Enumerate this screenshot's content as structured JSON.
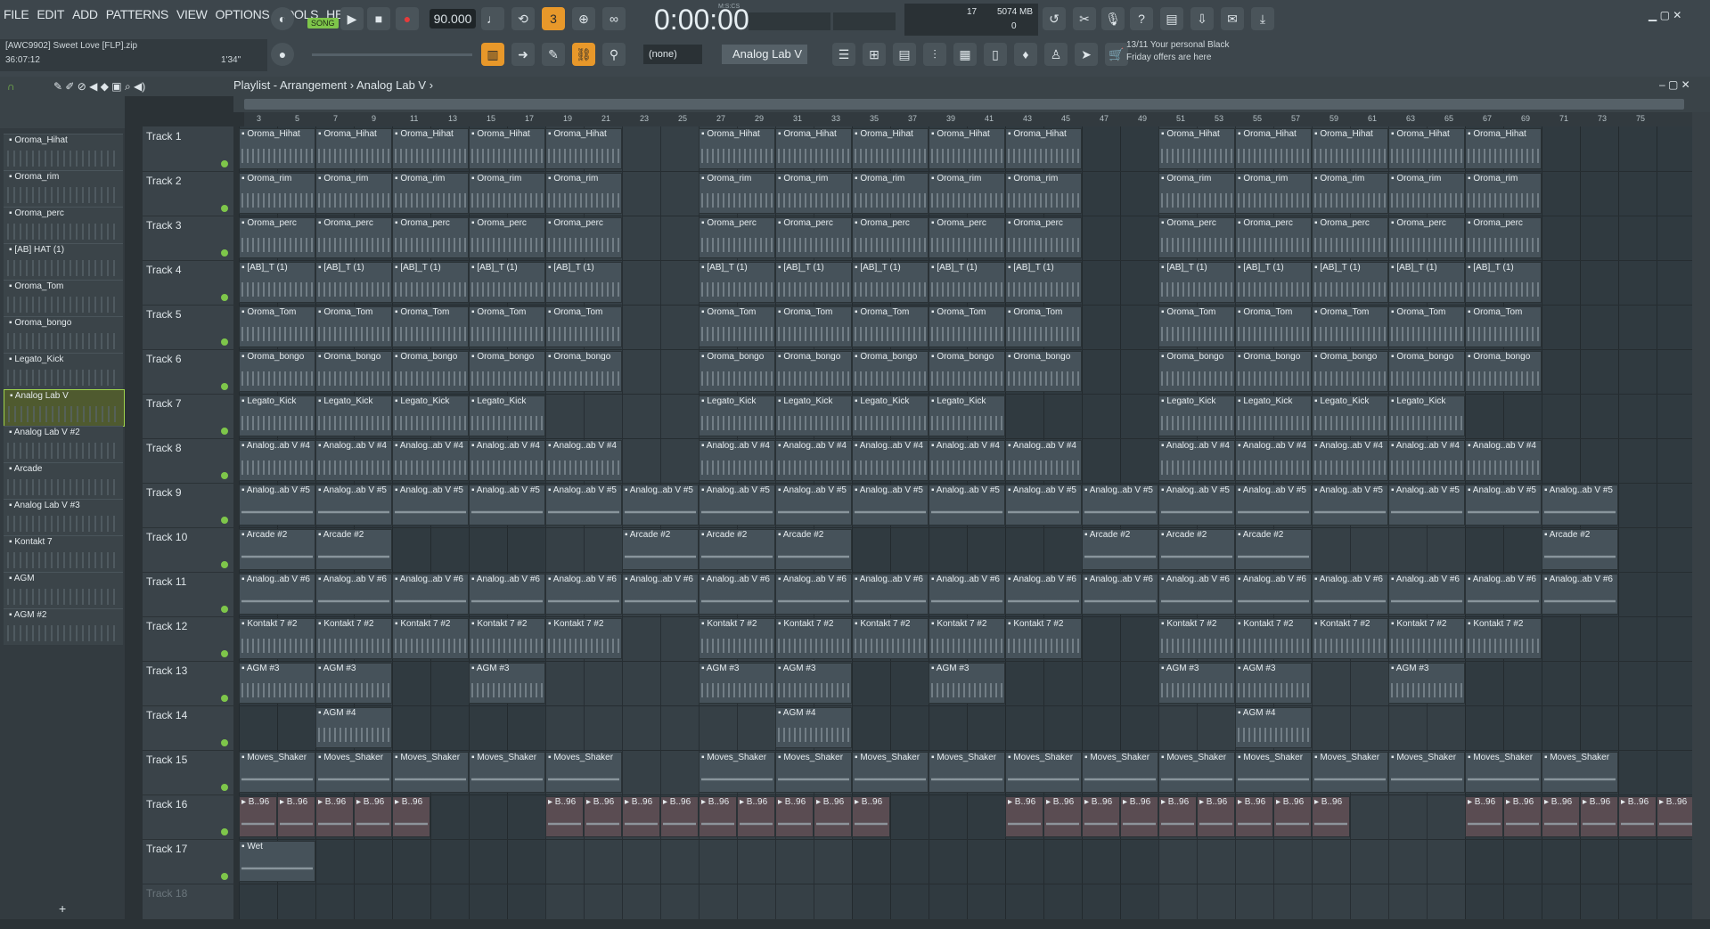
{
  "menu": [
    "FILE",
    "EDIT",
    "ADD",
    "PATTERNS",
    "VIEW",
    "OPTIONS",
    "TOOLS",
    "HELP"
  ],
  "transport": {
    "mode_label": "SONG",
    "tempo": "90.000",
    "time": "0:00:00",
    "time_unit": "M:S:CS"
  },
  "project": {
    "file": "[AWC9902] Sweet Love [FLP].zip",
    "time": "36:07:12",
    "length": "1'34\""
  },
  "cpu": {
    "voices": "17",
    "memory": "5074 MB",
    "zero": "0"
  },
  "pattern_selector": "(none)",
  "channel_selector": "Analog Lab V",
  "promo": {
    "count": "13/11",
    "line1": "Your personal Black",
    "line2": "Friday offers are here"
  },
  "playlist": {
    "title": "Playlist - Arrangement",
    "current": "Analog Lab V"
  },
  "ruler": [
    "3",
    "5",
    "7",
    "9",
    "11",
    "13",
    "15",
    "17",
    "19",
    "21",
    "23",
    "25",
    "27",
    "29",
    "31",
    "33",
    "35",
    "37",
    "39",
    "41",
    "43",
    "45",
    "47",
    "49",
    "51",
    "53",
    "55",
    "57",
    "59",
    "61",
    "63",
    "65",
    "67",
    "69",
    "71",
    "73",
    "75"
  ],
  "channels": [
    "Oroma_Hihat",
    "Oroma_rim",
    "Oroma_perc",
    "[AB] HAT (1)",
    "Oroma_Tom",
    "Oroma_bongo",
    "Legato_Kick",
    "Analog Lab V",
    "Analog Lab V #2",
    "Arcade",
    "Analog Lab V #3",
    "Kontakt 7",
    "AGM",
    "AGM #2"
  ],
  "tracks": [
    "Track 1",
    "Track 2",
    "Track 3",
    "Track 4",
    "Track 5",
    "Track 6",
    "Track 7",
    "Track 8",
    "Track 9",
    "Track 10",
    "Track 11",
    "Track 12",
    "Track 13",
    "Track 14",
    "Track 15",
    "Track 16",
    "Track 17",
    "Track 18"
  ],
  "clip_labels": {
    "t1": "Oroma_Hihat",
    "t2": "Oroma_rim",
    "t3": "Oroma_perc",
    "t4": "[AB]_T (1)",
    "t5": "Oroma_Tom",
    "t6": "Oroma_bongo",
    "t7": "Legato_Kick",
    "t8": "Analog..ab V #4",
    "t9": "Analog..ab V #5",
    "t10": "Arcade #2",
    "t11": "Analog..ab V #6",
    "t12": "Kontakt 7 #2",
    "t13": "AGM #3",
    "t14": "AGM #4",
    "t15": "Moves_Shaker",
    "t16": "B..96",
    "t17": "Wet"
  }
}
